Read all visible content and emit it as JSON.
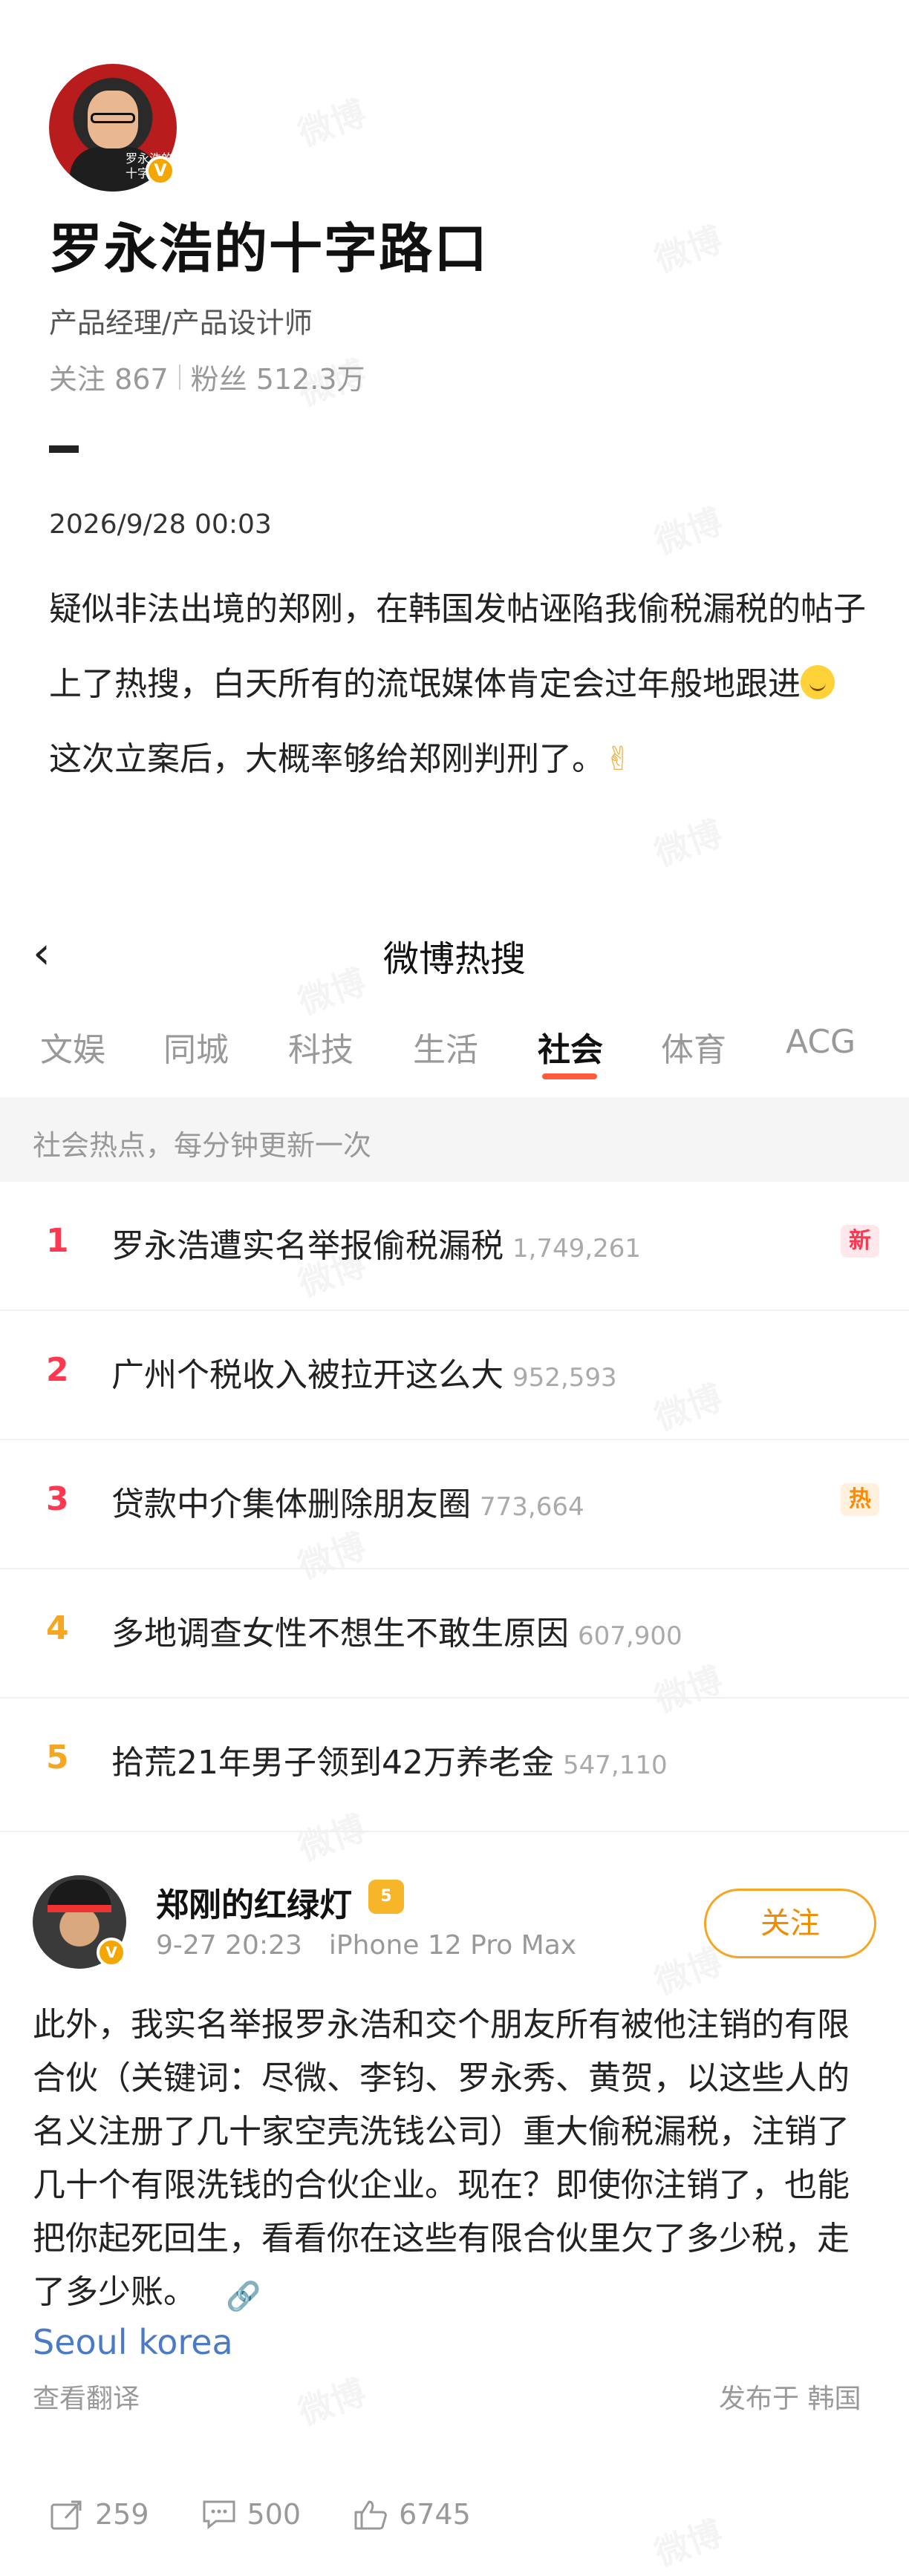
{
  "profile": {
    "avatar_caption": "罗永浩的十字路口",
    "name": "罗永浩的十字路口",
    "bio": "产品经理/产品设计师",
    "following_label": "关注",
    "following_count": "867",
    "followers_label": "粉丝",
    "followers_count": "512.3万"
  },
  "post": {
    "time": "2026/9/28 00:03",
    "text_part1": "疑似非法出境的郑刚，在韩国发帖诬陷我偷税漏税的帖子上了热搜，白天所有的流氓媒体肯定会过年般地跟进",
    "text_part2": " 这次立案后，大概率够给郑刚判刑了。"
  },
  "hot_search": {
    "title": "微博热搜",
    "tabs": [
      "文娱",
      "同城",
      "科技",
      "生活",
      "社会",
      "体育",
      "ACG"
    ],
    "active_tab": "社会",
    "banner": "社会热点，每分钟更新一次",
    "items": [
      {
        "rank": "1",
        "text": "罗永浩遭实名举报偷税漏税",
        "count": "1,749,261",
        "tag": "新"
      },
      {
        "rank": "2",
        "text": "广州个税收入被拉开这么大",
        "count": "952,593",
        "tag": ""
      },
      {
        "rank": "3",
        "text": "贷款中介集体删除朋友圈",
        "count": "773,664",
        "tag": "热"
      },
      {
        "rank": "4",
        "text": "多地调查女性不想生不敢生原因",
        "count": "607,900",
        "tag": ""
      },
      {
        "rank": "5",
        "text": "拾荒21年男子领到42万养老金",
        "count": "547,110",
        "tag": ""
      }
    ],
    "colors": {
      "rank1": "#ff3852",
      "rank2": "#ff3852",
      "rank3": "#ff3852",
      "rank4": "#f5a623",
      "rank5": "#f5a623"
    }
  },
  "post2": {
    "author": "郑刚的红绿灯",
    "time": "9-27 20:23",
    "device": "iPhone 12 Pro Max",
    "follow_label": "关注",
    "text": "此外，我实名举报罗永浩和交个朋友所有被他注销的有限合伙（关键词：尽微、李钧、罗永秀、黄贺，以这些人的名义注册了几十家空壳洗钱公司）重大偷税漏税，注销了几十个有限洗钱的合伙企业。现在？即使你注销了，也能把你起死回生，看看你在这些有限合伙里欠了多少税，走了多少账。",
    "location": "Seoul korea",
    "translate": "查看翻译",
    "published": "发布于 韩国",
    "reposts": "259",
    "comments": "500",
    "likes": "6745"
  },
  "watermark": "微博"
}
